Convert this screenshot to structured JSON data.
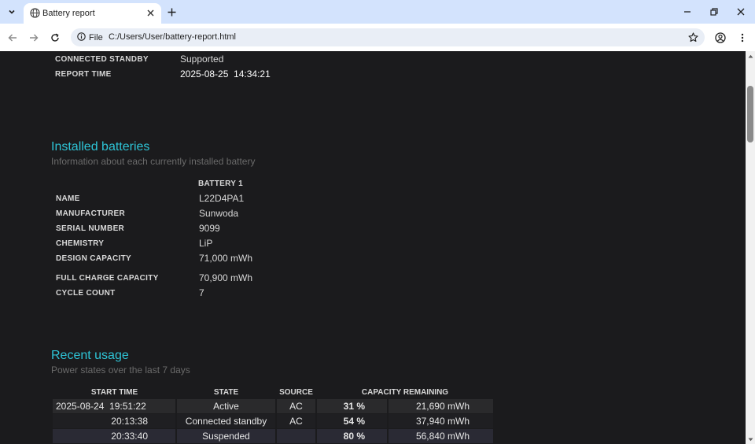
{
  "browser": {
    "tab_title": "Battery report",
    "site_chip_label": "File",
    "url": "C:/Users/User/battery-report.html"
  },
  "system_info": [
    {
      "label": "CONNECTED STANDBY",
      "value": "Supported"
    },
    {
      "label": "REPORT TIME",
      "value": "2025-08-25  14:34:21"
    }
  ],
  "installed_batteries": {
    "title": "Installed batteries",
    "subtitle": "Information about each currently installed battery",
    "column_header": "BATTERY 1",
    "rows": [
      {
        "label": "NAME",
        "value": "L22D4PA1"
      },
      {
        "label": "MANUFACTURER",
        "value": "Sunwoda"
      },
      {
        "label": "SERIAL NUMBER",
        "value": "9099"
      },
      {
        "label": "CHEMISTRY",
        "value": "LiP"
      },
      {
        "label": "DESIGN CAPACITY",
        "value": "71,000 mWh"
      },
      {
        "label": "FULL CHARGE CAPACITY",
        "value": "70,900 mWh"
      },
      {
        "label": "CYCLE COUNT",
        "value": "7"
      }
    ]
  },
  "recent_usage": {
    "title": "Recent usage",
    "subtitle": "Power states over the last 7 days",
    "headers": [
      "START TIME",
      "STATE",
      "SOURCE",
      "CAPACITY REMAINING"
    ],
    "rows": [
      {
        "start_time": "2025-08-24  19:51:22",
        "state": "Active",
        "source": "AC",
        "percent": "31 %",
        "mwh": "21,690 mWh"
      },
      {
        "start_time": "20:13:38",
        "state": "Connected standby",
        "source": "AC",
        "percent": "54 %",
        "mwh": "37,940 mWh"
      },
      {
        "start_time": "20:33:40",
        "state": "Suspended",
        "source": "",
        "percent": "80 %",
        "mwh": "56,840 mWh"
      }
    ]
  }
}
